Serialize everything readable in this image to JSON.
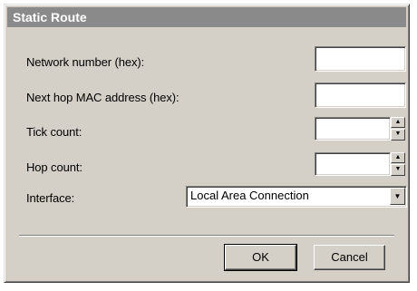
{
  "window": {
    "title": "Static Route"
  },
  "form": {
    "network_number": {
      "label": "Network number (hex):",
      "value": ""
    },
    "next_hop": {
      "label": "Next hop MAC address (hex):",
      "value": ""
    },
    "tick_count": {
      "label": "Tick count:",
      "value": ""
    },
    "hop_count": {
      "label": "Hop count:",
      "value": ""
    },
    "interface": {
      "label": "Interface:",
      "value": "Local Area Connection"
    }
  },
  "buttons": {
    "ok": "OK",
    "cancel": "Cancel"
  },
  "icons": {
    "spin_up": "up-arrow-icon",
    "spin_down": "down-arrow-icon",
    "dropdown": "chevron-down-icon"
  }
}
